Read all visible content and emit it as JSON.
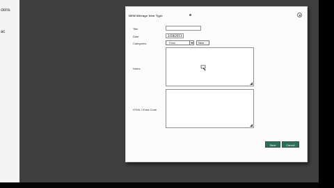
{
  "left_panel": {
    "line1": "ckins",
    "line2": "ac"
  },
  "dialog": {
    "title": "NEW Mileage Item Type"
  },
  "form": {
    "title_label": "Title",
    "date_label": "Date",
    "date_value": "2/28/2013",
    "categories_label": "Categories",
    "category_value": "Fees",
    "new_button_label": "New",
    "notes_label": "Notes",
    "html_label": "HTML / Extra Code"
  },
  "actions": {
    "save_label": "Save",
    "cancel_label": "Cancel"
  }
}
